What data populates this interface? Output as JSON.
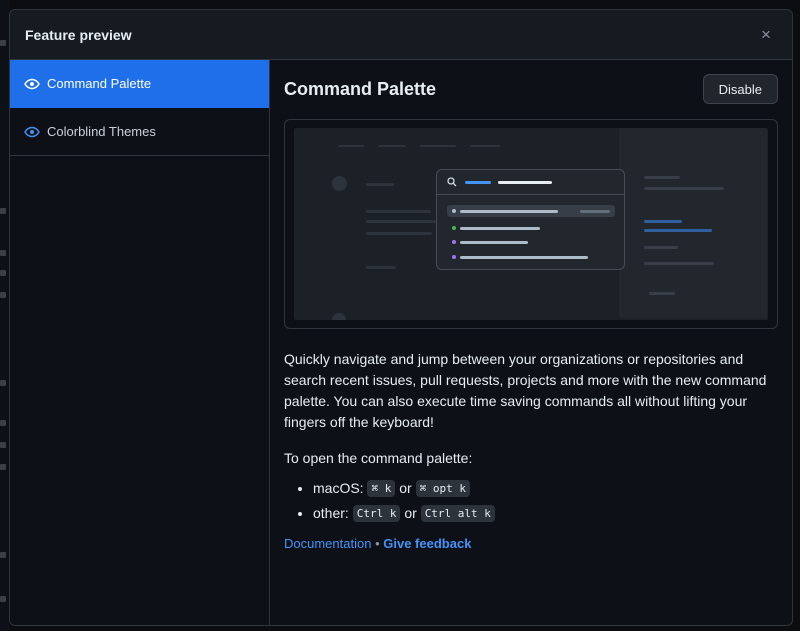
{
  "dialog": {
    "title": "Feature preview",
    "close_icon": "×"
  },
  "sidebar": {
    "items": [
      {
        "label": "Command Palette",
        "icon": "eye-icon",
        "active": true
      },
      {
        "label": "Colorblind Themes",
        "icon": "eye-icon",
        "active": false
      }
    ]
  },
  "content": {
    "title": "Command Palette",
    "disable_label": "Disable",
    "description": "Quickly navigate and jump between your organizations or repositories and search recent issues, pull requests, projects and more with the new command palette. You can also execute time saving commands all without lifting your fingers off the keyboard!",
    "open_label": "To open the command palette:",
    "shortcuts": {
      "mac_label": "macOS:",
      "mac_key1": "⌘ k",
      "mac_or": "or",
      "mac_key2": "⌘ opt k",
      "other_label": "other:",
      "other_key1": "Ctrl k",
      "other_or": "or",
      "other_key2": "Ctrl alt k"
    },
    "links": {
      "documentation": "Documentation",
      "separator": "•",
      "feedback": "Give feedback"
    }
  },
  "colors": {
    "accent": "#1f6feb",
    "link": "#4493f8",
    "background": "#0d1117",
    "border": "#30363d"
  }
}
